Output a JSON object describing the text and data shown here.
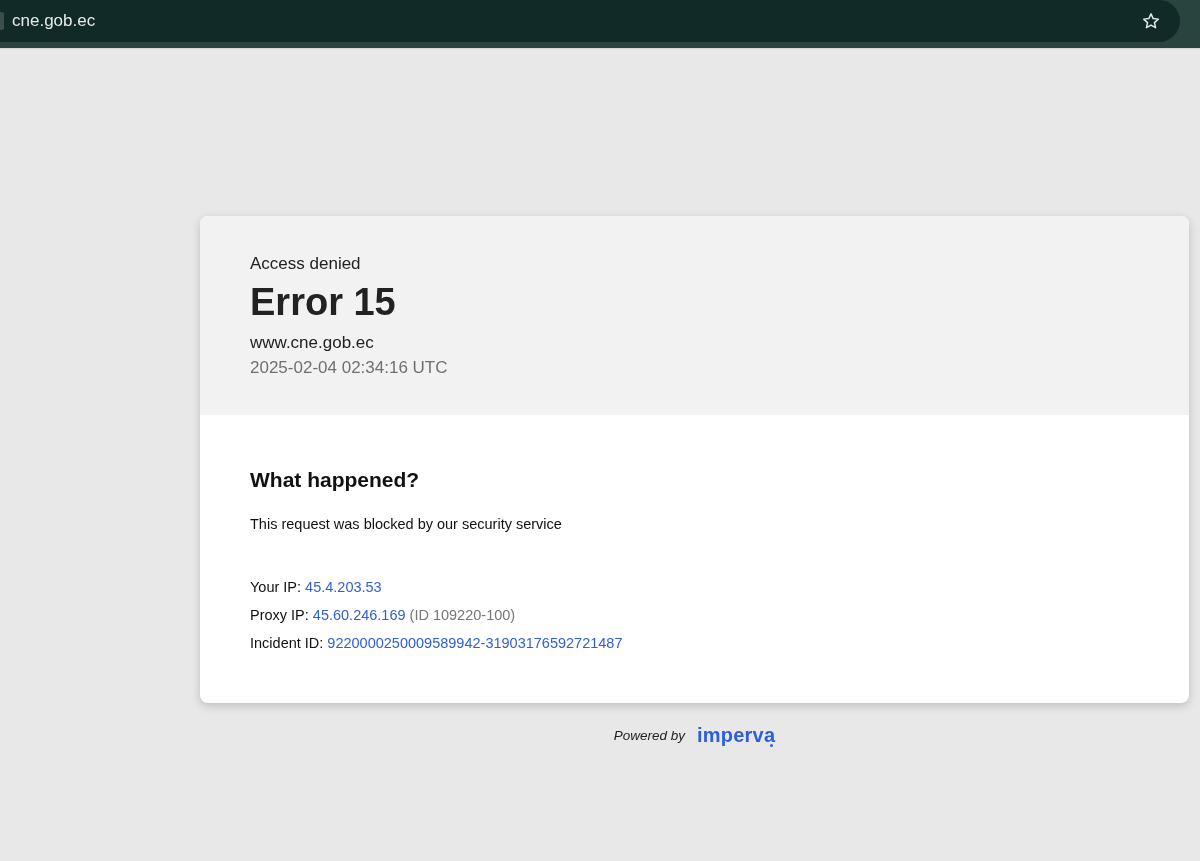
{
  "browser": {
    "address": "cne.gob.ec"
  },
  "error_card": {
    "header": {
      "label": "Access denied",
      "title": "Error 15",
      "host": "www.cne.gob.ec",
      "timestamp": "2025-02-04 02:34:16 UTC"
    },
    "body": {
      "heading": "What happened?",
      "message": "This request was blocked by our security service",
      "details": [
        {
          "label": "Your IP:",
          "value": "45.4.203.53"
        },
        {
          "label": "Proxy IP:",
          "value": "45.60.246.169",
          "note": "(ID 109220-100)"
        },
        {
          "label": "Incident ID:",
          "value": "9220000250009589942-31903176592721487"
        }
      ]
    }
  },
  "footer": {
    "powered_by": "Powered by",
    "brand": "imperva"
  }
}
